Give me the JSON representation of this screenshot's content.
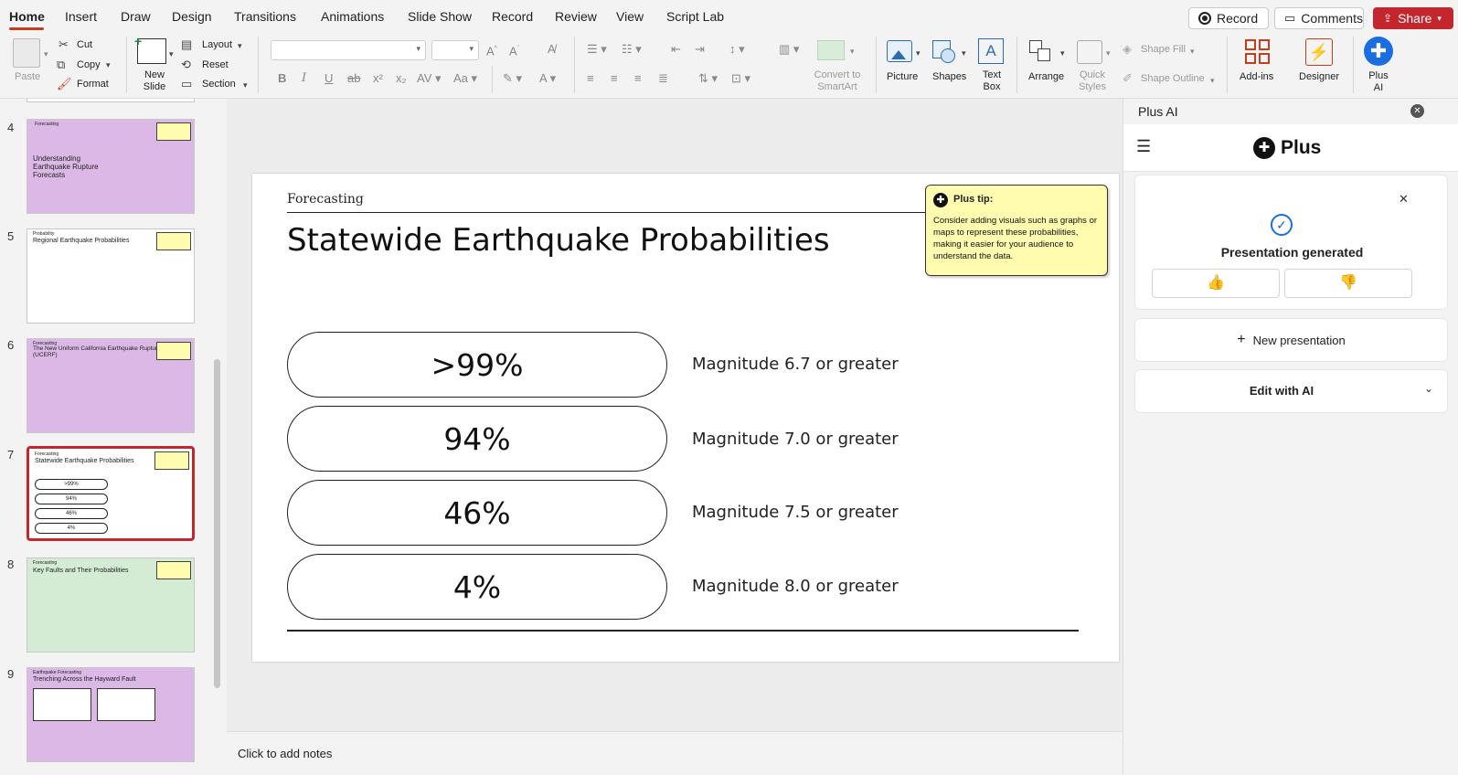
{
  "tabs": [
    "Home",
    "Insert",
    "Draw",
    "Design",
    "Transitions",
    "Animations",
    "Slide Show",
    "Record",
    "Review",
    "View",
    "Script Lab"
  ],
  "top_buttons": {
    "record": "Record",
    "comments": "Comments",
    "share": "Share"
  },
  "ribbon": {
    "paste": "Paste",
    "cut": "Cut",
    "copy": "Copy",
    "format": "Format",
    "new_slide": "New Slide",
    "layout": "Layout",
    "reset": "Reset",
    "section": "Section",
    "convert_smartart": "Convert to SmartArt",
    "picture": "Picture",
    "shapes": "Shapes",
    "text_box": "Text Box",
    "arrange": "Arrange",
    "quick_styles": "Quick Styles",
    "shape_fill": "Shape Fill",
    "shape_outline": "Shape Outline",
    "add_ins": "Add-ins",
    "designer": "Designer",
    "plus_ai": "Plus AI",
    "font_name": "",
    "font_size": ""
  },
  "thumbnails": [
    {
      "num": "4",
      "title": "Understanding Earthquake Rupture Forecasts",
      "kicker": "Forecasting"
    },
    {
      "num": "5",
      "title": "Regional Earthquake Probabilities",
      "kicker": "Probability"
    },
    {
      "num": "6",
      "title": "The New Uniform California Earthquake Rupture (UCERF)",
      "kicker": "Forecasting"
    },
    {
      "num": "7",
      "title": "Statewide Earthquake Probabilities",
      "kicker": "Forecasting",
      "pills": [
        ">99%",
        "94%",
        "46%",
        "4%"
      ]
    },
    {
      "num": "8",
      "title": "Key Faults and Their Probabilities",
      "kicker": "Forecasting"
    },
    {
      "num": "9",
      "title": "Trenching Across the Hayward Fault",
      "kicker": "Earthquake Forecasting"
    }
  ],
  "slide": {
    "kicker": "Forecasting",
    "title": "Statewide Earthquake Probabilities",
    "tip_heading": "Plus tip:",
    "tip_body": "Consider adding visuals such as graphs or maps to represent these probabilities, making it easier for your audience to understand the data.",
    "rows": [
      {
        "value": ">99%",
        "label": "Magnitude 6.7 or greater"
      },
      {
        "value": "94%",
        "label": "Magnitude 7.0 or greater"
      },
      {
        "value": "46%",
        "label": "Magnitude 7.5 or greater"
      },
      {
        "value": "4%",
        "label": "Magnitude 8.0 or greater"
      }
    ]
  },
  "notes_placeholder": "Click to add notes",
  "panel": {
    "header": "Plus AI",
    "logo_text": "Plus",
    "status": "Presentation generated",
    "new_presentation": "New presentation",
    "edit_with_ai": "Edit with AI"
  },
  "colors": {
    "accent": "#c43e1c",
    "share": "#c4262e",
    "tip_bg": "#fffcb0",
    "plus_blue": "#1a6fe0",
    "thumb_purple": "#dcb8e6",
    "thumb_green": "#d5ecd4"
  }
}
